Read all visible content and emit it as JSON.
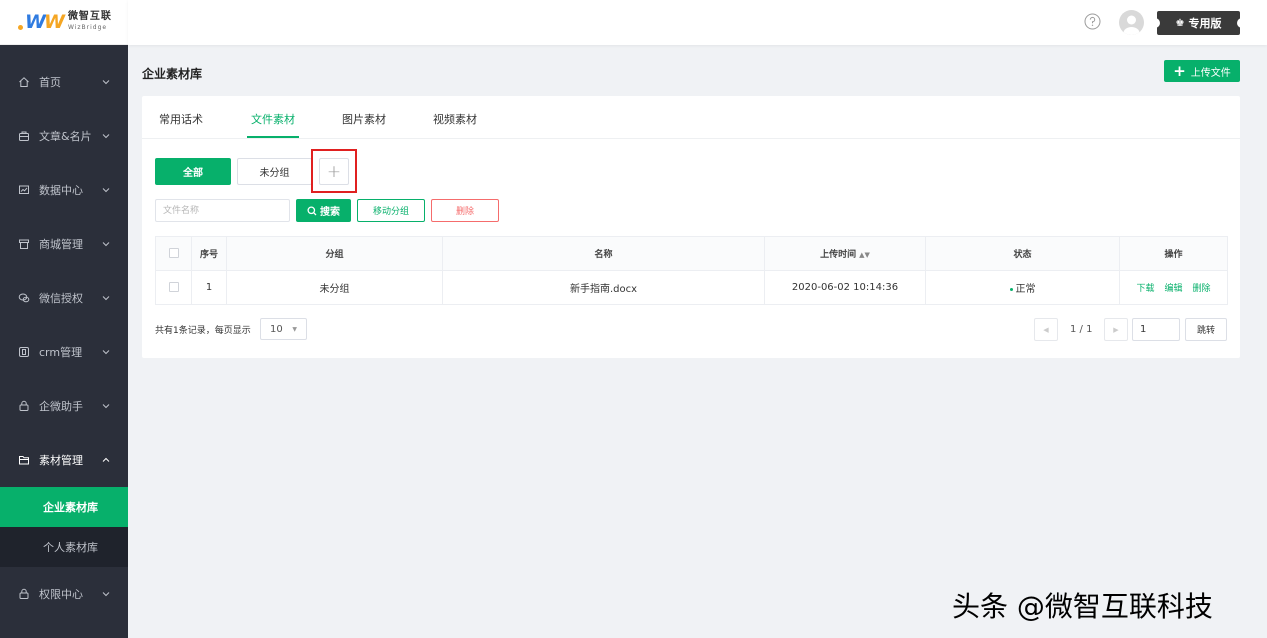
{
  "brand": {
    "logo_cn": "微智互联",
    "logo_en": "WizBridge"
  },
  "topbar": {
    "edition_label": "专用版"
  },
  "sidebar": {
    "items": [
      {
        "label": "首页",
        "icon": "home-icon"
      },
      {
        "label": "文章&名片",
        "icon": "briefcase-icon"
      },
      {
        "label": "数据中心",
        "icon": "chart-icon"
      },
      {
        "label": "商城管理",
        "icon": "shop-icon"
      },
      {
        "label": "微信授权",
        "icon": "wechat-icon"
      },
      {
        "label": "crm管理",
        "icon": "crm-icon"
      },
      {
        "label": "企微助手",
        "icon": "lock-icon"
      },
      {
        "label": "素材管理",
        "icon": "folder-icon"
      },
      {
        "label": "权限中心",
        "icon": "lock-icon"
      }
    ],
    "submenu": [
      {
        "label": "企业素材库",
        "active": true
      },
      {
        "label": "个人素材库",
        "active": false
      }
    ]
  },
  "page": {
    "title": "企业素材库",
    "upload_label": "上传文件"
  },
  "tabs": [
    "常用话术",
    "文件素材",
    "图片素材",
    "视频素材"
  ],
  "active_tab": "文件素材",
  "groups": {
    "all_label": "全部",
    "ungrouped_label": "未分组",
    "add_symbol": "+"
  },
  "filters": {
    "search_placeholder": "文件名称",
    "search_label": "搜索",
    "move_label": "移动分组",
    "delete_label": "删除"
  },
  "table": {
    "headers": {
      "index": "序号",
      "group": "分组",
      "name": "名称",
      "upload_time": "上传时间",
      "status": "状态",
      "actions": "操作"
    },
    "rows": [
      {
        "index": "1",
        "group": "未分组",
        "name": "新手指南.docx",
        "upload_time": "2020-06-02 10:14:36",
        "status": "正常",
        "actions": [
          "下载",
          "编辑",
          "删除"
        ]
      }
    ]
  },
  "pagination": {
    "total_text": "共有1条记录，每页显示",
    "page_size": "10",
    "page_info": "1 / 1",
    "page_input": "1",
    "jump_label": "跳转"
  },
  "watermark": "头条 @微智互联科技",
  "colors": {
    "accent": "#07b06b",
    "sidebar_bg": "#2b2f3a",
    "danger": "#f56c6c",
    "highlight_box": "#e02020"
  }
}
